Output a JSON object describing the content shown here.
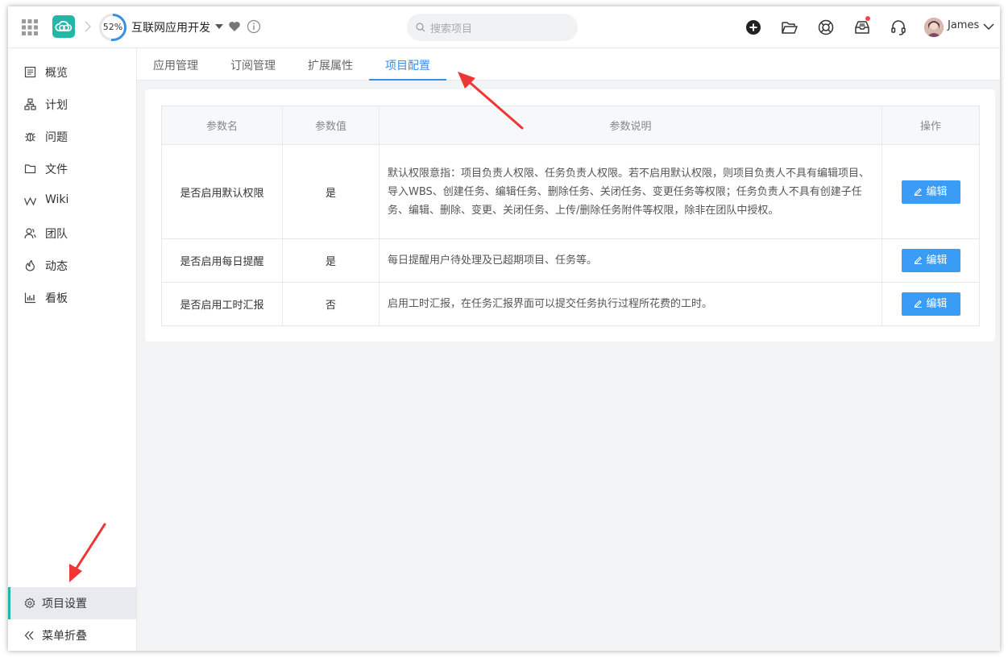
{
  "header": {
    "progress": "52%",
    "progress_value": 0.52,
    "project_name": "互联网应用开发",
    "search_placeholder": "搜索项目",
    "username": "James"
  },
  "sidebar": {
    "items": [
      {
        "label": "概览",
        "icon": "overview-icon"
      },
      {
        "label": "计划",
        "icon": "plan-icon"
      },
      {
        "label": "问题",
        "icon": "bug-icon"
      },
      {
        "label": "文件",
        "icon": "folder-icon"
      },
      {
        "label": "Wiki",
        "icon": "wiki-icon"
      },
      {
        "label": "团队",
        "icon": "team-icon"
      },
      {
        "label": "动态",
        "icon": "activity-icon"
      },
      {
        "label": "看板",
        "icon": "board-icon"
      }
    ],
    "settings": "项目设置",
    "collapse": "菜单折叠"
  },
  "tabs": [
    {
      "label": "应用管理",
      "active": false
    },
    {
      "label": "订阅管理",
      "active": false
    },
    {
      "label": "扩展属性",
      "active": false
    },
    {
      "label": "项目配置",
      "active": true
    }
  ],
  "table": {
    "headers": [
      "参数名",
      "参数值",
      "参数说明",
      "操作"
    ],
    "rows": [
      {
        "name": "是否启用默认权限",
        "value": "是",
        "description": "默认权限意指：项目负责人权限、任务负责人权限。若不启用默认权限，则项目负责人不具有编辑项目、导入WBS、创建任务、编辑任务、删除任务、关闭任务、变更任务等权限；任务负责人不具有创建子任务、编辑、删除、变更、关闭任务、上传/删除任务附件等权限，除非在团队中授权。",
        "action": "编辑"
      },
      {
        "name": "是否启用每日提醒",
        "value": "是",
        "description": "每日提醒用户待处理及已超期项目、任务等。",
        "action": "编辑"
      },
      {
        "name": "是否启用工时汇报",
        "value": "否",
        "description": "启用工时汇报，在任务汇报界面可以提交任务执行过程所花费的工时。",
        "action": "编辑"
      }
    ]
  },
  "colors": {
    "accent": "#3a8ee6",
    "brand": "#23b7a7",
    "button": "#3a9cf5",
    "annotation_arrow": "#f03535"
  }
}
